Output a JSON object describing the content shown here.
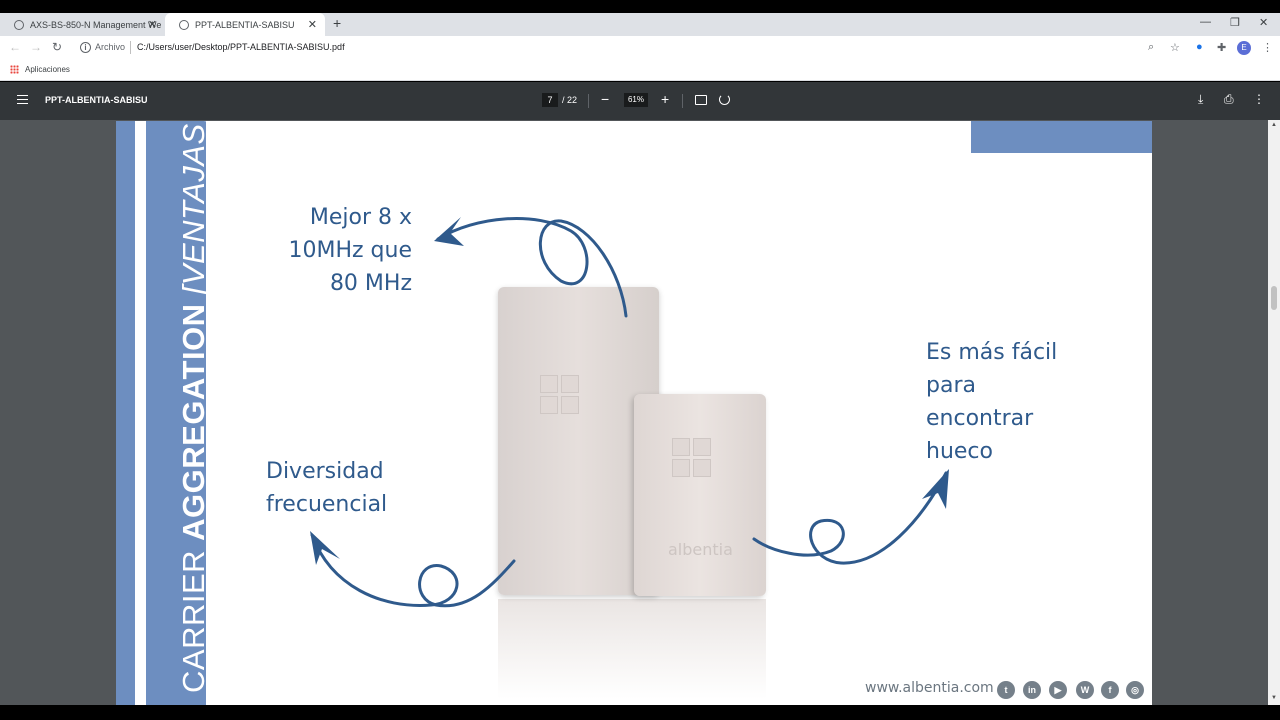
{
  "browser": {
    "tabs": [
      {
        "title": "AXS-BS-850-N Management We"
      },
      {
        "title": "PPT-ALBENTIA-SABISU"
      }
    ],
    "new_tab": "+",
    "address": {
      "scheme_label": "Archivo",
      "url": "C:/Users/user/Desktop/PPT-ALBENTIA-SABISU.pdf"
    },
    "profile_initial": "E",
    "bookmarks": {
      "apps_label": "Aplicaciones"
    }
  },
  "pdf_viewer": {
    "title": "PPT-ALBENTIA-SABISU",
    "current_page": "7",
    "total_pages": "/ 22",
    "zoom": "61%"
  },
  "slide": {
    "title_part1": "CARRIER ",
    "title_part2": "AGGREGATION ",
    "title_part3": "[VENTAJAS]",
    "label_top_left": [
      "Mejor 8 x",
      "10MHz que",
      "80 MHz"
    ],
    "label_bottom_left": [
      "Diversidad",
      "frecuencial"
    ],
    "label_right": [
      "Es más fácil",
      "para",
      "encontrar",
      "hueco"
    ],
    "device_brand": "albentia",
    "website": "www.albentia.com",
    "social": [
      "twitter",
      "linkedin",
      "youtube",
      "wordpress",
      "facebook",
      "instagram"
    ],
    "accent_color": "#6d8ec0",
    "text_color": "#2f5a8c"
  }
}
